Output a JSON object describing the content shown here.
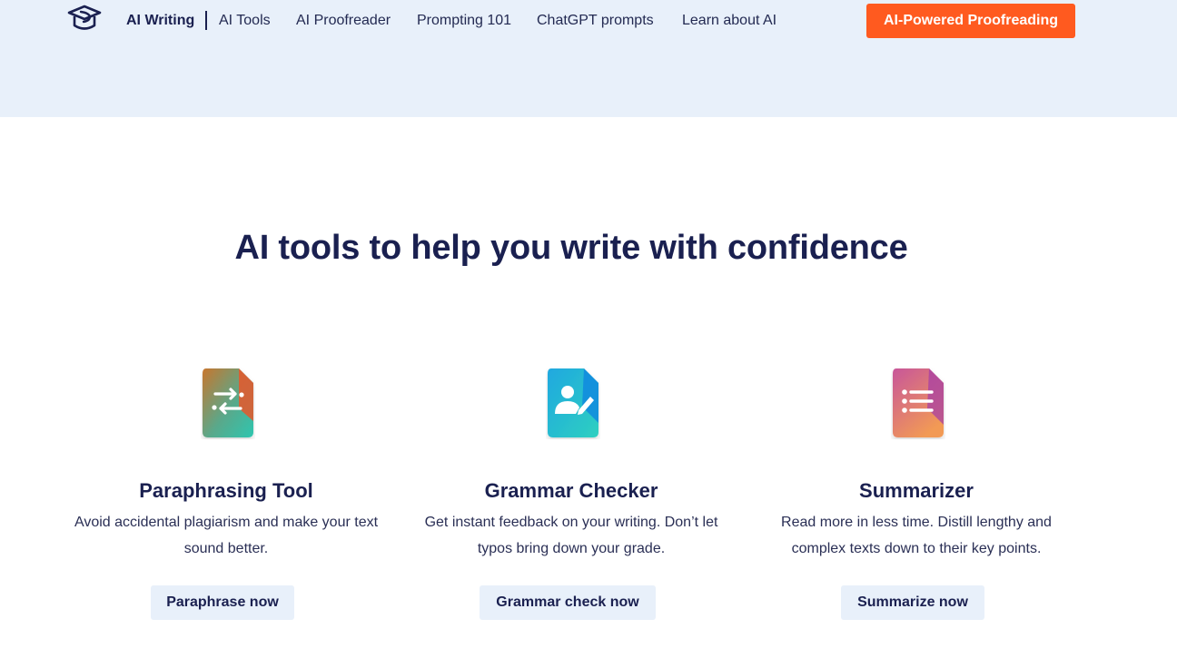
{
  "nav": {
    "brand": "AI Writing",
    "links": [
      "AI Tools",
      "AI Proofreader",
      "Prompting 101",
      "ChatGPT prompts",
      "Learn about AI"
    ],
    "cta": "AI-Powered Proofreading"
  },
  "headline": "AI tools to help you write with confidence",
  "tools": [
    {
      "title": "Paraphrasing Tool",
      "description": "Avoid accidental plagiarism and make your text sound better.",
      "button": "Paraphrase now",
      "icon": "paraphrase-arrows-icon"
    },
    {
      "title": "Grammar Checker",
      "description": "Get instant feedback on your writing. Don’t let typos bring down your grade.",
      "button": "Grammar check now",
      "icon": "grammar-person-pen-icon"
    },
    {
      "title": "Summarizer",
      "description": "Read more in less time. Distill lengthy and complex texts down to their key points.",
      "button": "Summarize now",
      "icon": "summarizer-list-icon"
    }
  ],
  "colors": {
    "brand_navy": "#1a2050",
    "cta_orange": "#ff5a1f",
    "band_blue": "#e8f0fa"
  }
}
